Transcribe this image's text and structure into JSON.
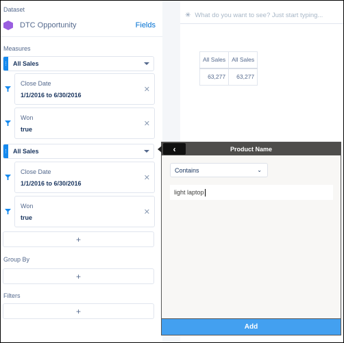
{
  "dataset": {
    "label": "Dataset",
    "name": "DTC Opportunity",
    "fields_link": "Fields"
  },
  "measures": {
    "label": "Measures",
    "items": [
      {
        "name": "All Sales",
        "filters": [
          {
            "field": "Close Date",
            "value": "1/1/2016 to 6/30/2016"
          },
          {
            "field": "Won",
            "value": "true"
          }
        ]
      },
      {
        "name": "All Sales",
        "filters": [
          {
            "field": "Close Date",
            "value": "1/1/2016 to 6/30/2016"
          },
          {
            "field": "Won",
            "value": "true"
          }
        ]
      }
    ],
    "add": "+"
  },
  "group_by": {
    "label": "Group By",
    "add": "+"
  },
  "filters": {
    "label": "Filters",
    "add": "+"
  },
  "search": {
    "placeholder": "What do you want to see? Just start typing..."
  },
  "table": {
    "headers": [
      "All Sales",
      "All Sales"
    ],
    "rows": [
      [
        "63,277",
        "63,277"
      ]
    ]
  },
  "popover": {
    "title": "Product Name",
    "operator": "Contains",
    "value": "light laptop",
    "add_label": "Add"
  },
  "colors": {
    "accent": "#1589ee",
    "add_button": "#43a0f0",
    "dataset_icon": "#9a5ee0"
  }
}
